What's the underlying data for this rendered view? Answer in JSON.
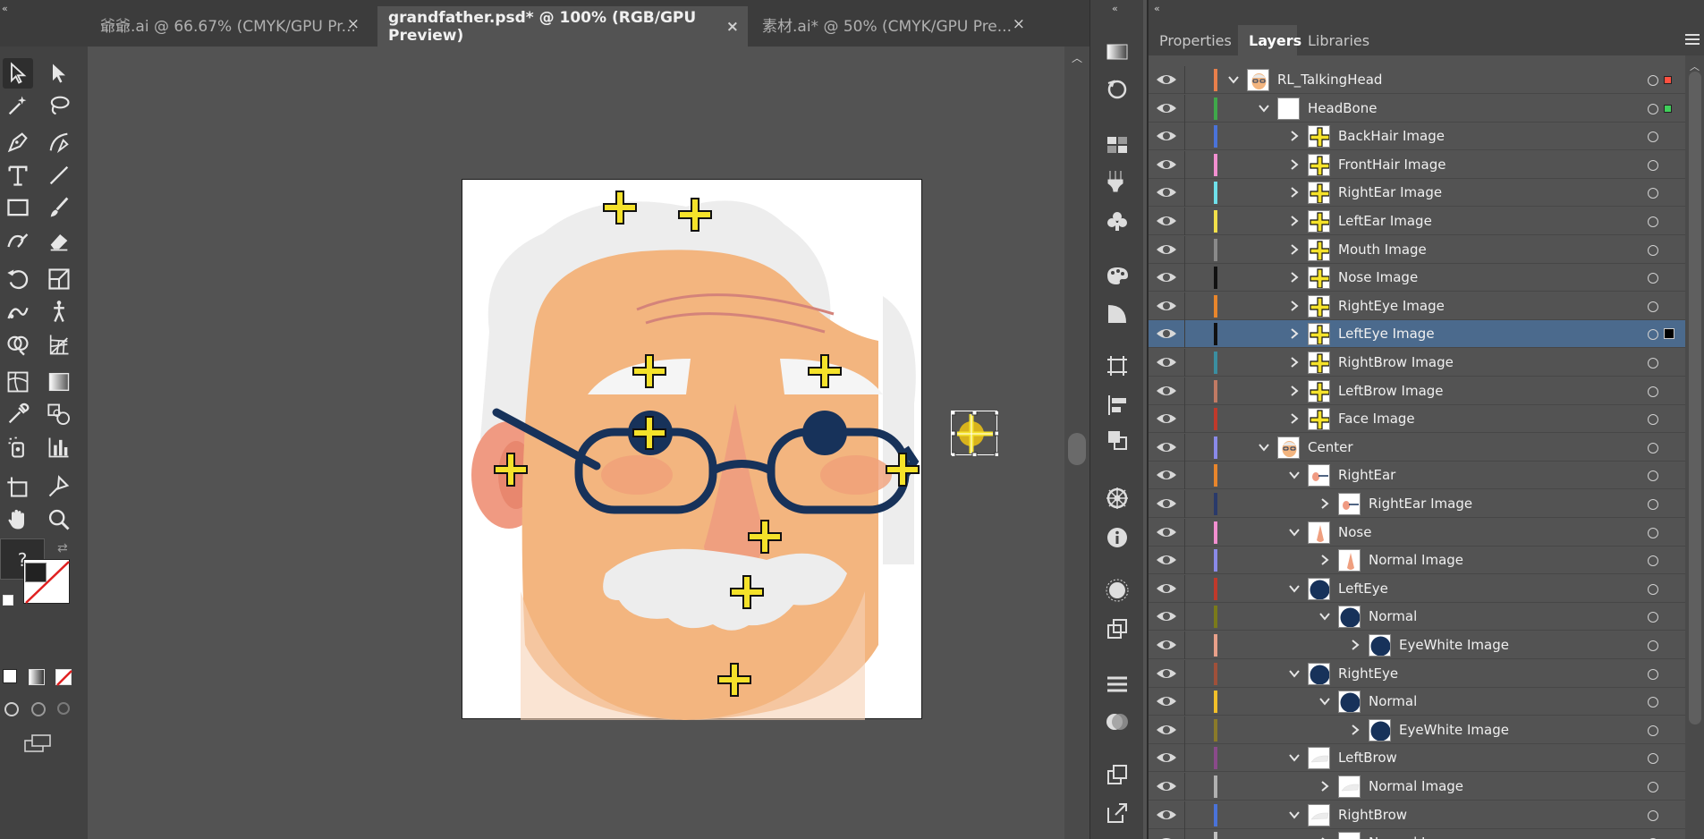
{
  "tabs": [
    {
      "label": "爺爺.ai @ 66.67% (CMYK/GPU Pr...",
      "close": "×",
      "active": false
    },
    {
      "label": "grandfather.psd* @ 100% (RGB/GPU Preview)",
      "close": "×",
      "active": true
    },
    {
      "label": "素材.ai* @ 50% (CMYK/GPU Pre...",
      "close": "×",
      "active": false
    }
  ],
  "panel": {
    "tabs": [
      "Properties",
      "Layers",
      "Libraries"
    ],
    "active_tab": "Layers"
  },
  "toolbar": {
    "help_glyph": "?"
  },
  "layers": [
    {
      "name": "RL_TalkingHead",
      "depth": 0,
      "expanded": true,
      "color": "#e87f4b",
      "thumb": "face",
      "sel": "#ff5040"
    },
    {
      "name": "HeadBone",
      "depth": 1,
      "expanded": true,
      "color": "#3fa84a",
      "thumb": "blank",
      "sel": "#3fcf5a"
    },
    {
      "name": "BackHair Image",
      "depth": 2,
      "expanded": false,
      "color": "#4a73d9",
      "thumb": "cross"
    },
    {
      "name": "FrontHair Image",
      "depth": 2,
      "expanded": false,
      "color": "#f28fd0",
      "thumb": "cross"
    },
    {
      "name": "RightEar Image",
      "depth": 2,
      "expanded": false,
      "color": "#6fe0ea",
      "thumb": "cross"
    },
    {
      "name": "LeftEar Image",
      "depth": 2,
      "expanded": false,
      "color": "#f2e04a",
      "thumb": "cross"
    },
    {
      "name": "Mouth Image",
      "depth": 2,
      "expanded": false,
      "color": "#8a8a8a",
      "thumb": "cross"
    },
    {
      "name": "Nose Image",
      "depth": 2,
      "expanded": false,
      "color": "#111111",
      "thumb": "cross"
    },
    {
      "name": "RightEye Image",
      "depth": 2,
      "expanded": false,
      "color": "#e8862c",
      "thumb": "cross"
    },
    {
      "name": "LeftEye Image",
      "depth": 2,
      "expanded": false,
      "color": "#111111",
      "thumb": "cross",
      "selected": true,
      "sel": "#000000"
    },
    {
      "name": "RightBrow Image",
      "depth": 2,
      "expanded": false,
      "color": "#3b8ea0",
      "thumb": "cross"
    },
    {
      "name": "LeftBrow Image",
      "depth": 2,
      "expanded": false,
      "color": "#c07a64",
      "thumb": "cross"
    },
    {
      "name": "Face Image",
      "depth": 2,
      "expanded": false,
      "color": "#c0392b",
      "thumb": "cross"
    },
    {
      "name": "Center",
      "depth": 1,
      "expanded": true,
      "color": "#8a8ae8",
      "thumb": "face"
    },
    {
      "name": "RightEar",
      "depth": 2,
      "expanded": true,
      "color": "#e8862c",
      "thumb": "smallface"
    },
    {
      "name": "RightEar Image",
      "depth": 3,
      "expanded": false,
      "color": "#2a3a6a",
      "thumb": "smallface"
    },
    {
      "name": "Nose",
      "depth": 2,
      "expanded": true,
      "color": "#f28fd0",
      "thumb": "nose"
    },
    {
      "name": "Normal Image",
      "depth": 3,
      "expanded": false,
      "color": "#8a8ae8",
      "thumb": "nose"
    },
    {
      "name": "LeftEye",
      "depth": 2,
      "expanded": true,
      "color": "#c0392b",
      "thumb": "eye"
    },
    {
      "name": "Normal",
      "depth": 3,
      "expanded": true,
      "color": "#7a7a1a",
      "thumb": "eye"
    },
    {
      "name": "EyeWhite Image",
      "depth": 4,
      "expanded": false,
      "color": "#e8a08a",
      "thumb": "eye"
    },
    {
      "name": "RightEye",
      "depth": 2,
      "expanded": true,
      "color": "#a0503a",
      "thumb": "eye"
    },
    {
      "name": "Normal",
      "depth": 3,
      "expanded": true,
      "color": "#f2c02a",
      "thumb": "eye"
    },
    {
      "name": "EyeWhite Image",
      "depth": 4,
      "expanded": false,
      "color": "#8a7a2a",
      "thumb": "eye"
    },
    {
      "name": "LeftBrow",
      "depth": 2,
      "expanded": true,
      "color": "#8a4a8a",
      "thumb": "brow"
    },
    {
      "name": "Normal Image",
      "depth": 3,
      "expanded": false,
      "color": "#b0b0b0",
      "thumb": "brow"
    },
    {
      "name": "RightBrow",
      "depth": 2,
      "expanded": true,
      "color": "#4a73d9",
      "thumb": "brow"
    },
    {
      "name": "Normal Image",
      "depth": 3,
      "expanded": false,
      "color": "#c0c0c0",
      "thumb": "brow"
    }
  ],
  "colors": {
    "accent_selection": "#4b6a8d",
    "bone_marker": "#f5e22a",
    "glasses": "#17325a",
    "skin": "#f3b57f"
  }
}
